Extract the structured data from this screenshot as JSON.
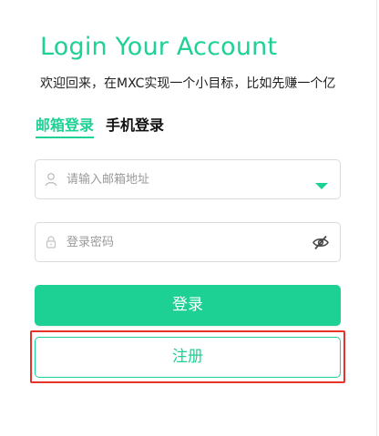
{
  "header": {
    "title": "Login Your Account",
    "subtitle": "欢迎回来，在MXC实现一个小目标，比如先赚一个亿"
  },
  "tabs": [
    {
      "label": "邮箱登录",
      "active": true
    },
    {
      "label": "手机登录",
      "active": false
    }
  ],
  "form": {
    "email": {
      "value": "",
      "placeholder": "请输入邮箱地址",
      "icon": "user-icon",
      "suffix_icon": "dropdown-caret-icon"
    },
    "password": {
      "value": "",
      "placeholder": "登录密码",
      "icon": "lock-icon",
      "suffix_icon": "eye-off-icon"
    }
  },
  "buttons": {
    "login": "登录",
    "register": "注册"
  },
  "colors": {
    "accent": "#1dd194",
    "highlight": "#e5332a"
  }
}
